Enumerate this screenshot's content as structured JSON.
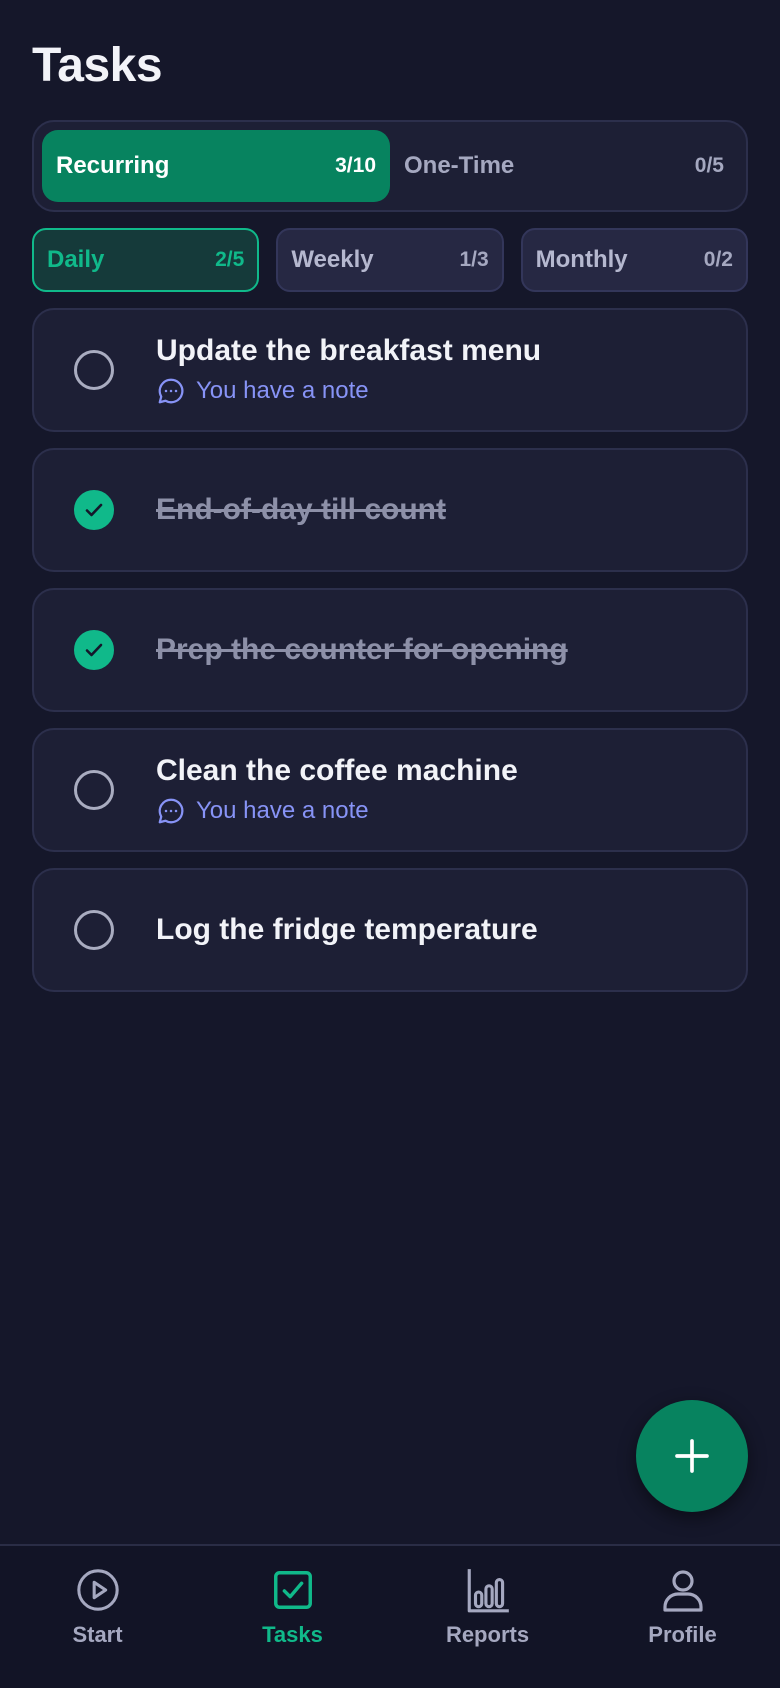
{
  "header": {
    "title": "Tasks"
  },
  "segment": {
    "tabs": [
      {
        "label": "Recurring",
        "count": "3/10",
        "active": true
      },
      {
        "label": "One-Time",
        "count": "0/5",
        "active": false
      }
    ]
  },
  "filters": {
    "chips": [
      {
        "label": "Daily",
        "count": "2/5",
        "active": true
      },
      {
        "label": "Weekly",
        "count": "1/3",
        "active": false
      },
      {
        "label": "Monthly",
        "count": "0/2",
        "active": false
      }
    ]
  },
  "tasks": [
    {
      "title": "Update the breakfast menu",
      "done": false,
      "note": "You have a note"
    },
    {
      "title": "End-of-day till count",
      "done": true,
      "note": ""
    },
    {
      "title": "Prep the counter for opening",
      "done": true,
      "note": ""
    },
    {
      "title": "Clean the coffee machine",
      "done": false,
      "note": "You have a note"
    },
    {
      "title": "Log the fridge temperature",
      "done": false,
      "note": ""
    }
  ],
  "fab": {
    "icon": "plus-icon"
  },
  "nav": {
    "items": [
      {
        "label": "Start",
        "icon": "play-circle-icon",
        "active": false
      },
      {
        "label": "Tasks",
        "icon": "checkbox-icon",
        "active": true
      },
      {
        "label": "Reports",
        "icon": "bar-chart-icon",
        "active": false
      },
      {
        "label": "Profile",
        "icon": "user-icon",
        "active": false
      }
    ]
  },
  "colors": {
    "background": "#15172a",
    "accent": "#07835f",
    "accent_bright": "#10b98a",
    "note": "#8793f6",
    "card": "#1d1f35"
  }
}
